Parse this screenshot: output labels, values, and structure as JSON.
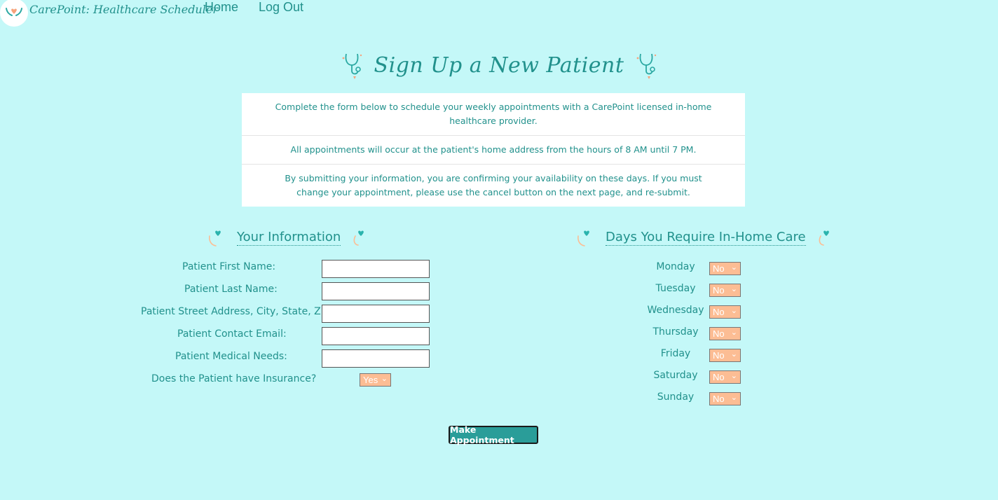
{
  "header": {
    "brand": "CarePoint: Healthcare Scheduler",
    "nav": {
      "home": "Home",
      "logout": "Log Out"
    }
  },
  "title": "Sign Up a New Patient",
  "info": {
    "line1": "Complete the form below to schedule your weekly appointments with a CarePoint licensed in-home healthcare provider.",
    "line2": "All appointments will occur at the patient's home address from the hours of 8 AM until 7 PM.",
    "line3": "By submitting your information, you are confirming your availability on these days. If you must change your appointment, please use the cancel button on the next page, and re-submit."
  },
  "your_info": {
    "heading": "Your Information",
    "fields": [
      {
        "label": "Patient First Name:",
        "value": ""
      },
      {
        "label": "Patient Last Name:",
        "value": ""
      },
      {
        "label": "Patient Street Address, City, State, Zip:",
        "value": ""
      },
      {
        "label": "Patient Contact Email:",
        "value": ""
      },
      {
        "label": "Patient Medical Needs:",
        "value": ""
      }
    ],
    "insurance": {
      "label": "Does the Patient have Insurance?",
      "value": "Yes"
    }
  },
  "days": {
    "heading": "Days You Require In-Home Care",
    "items": [
      {
        "label": "Monday",
        "value": "No"
      },
      {
        "label": "Tuesday",
        "value": "No"
      },
      {
        "label": "Wednesday",
        "value": "No"
      },
      {
        "label": "Thursday",
        "value": "No"
      },
      {
        "label": "Friday",
        "value": "No"
      },
      {
        "label": "Saturday",
        "value": "No"
      },
      {
        "label": "Sunday",
        "value": "No"
      }
    ]
  },
  "submit_label": "Make Appointment",
  "colors": {
    "background": "#c4f8f8",
    "accent": "#21918c",
    "select_bg": "#fcbd94",
    "button_bg": "#2a9d99"
  },
  "icons": {
    "logo": "hearts-hands-icon",
    "title": "stethoscope-icon",
    "section": "heart-icon"
  }
}
